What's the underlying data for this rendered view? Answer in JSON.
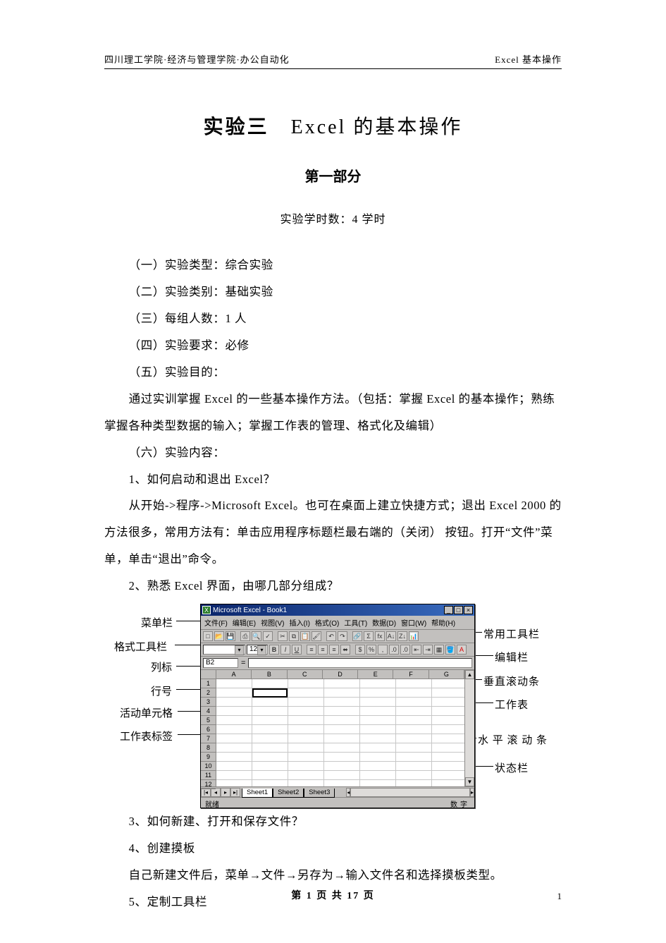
{
  "header": {
    "left": "四川理工学院·经济与管理学院·办公自动化",
    "right": "Excel 基本操作"
  },
  "title": {
    "bold": "实验三",
    "rest": "　Excel 的基本操作"
  },
  "subtitle": "第一部分",
  "hours": "实验学时数：4 学时",
  "items": {
    "i1": "（一）实验类型：综合实验",
    "i2": "（二）实验类别：基础实验",
    "i3": "（三）每组人数：1 人",
    "i4": "（四）实验要求：必修",
    "i5": "（五）实验目的：",
    "i5p": "通过实训掌握 Excel 的一些基本操作方法。（包括：掌握 Excel 的基本操作；熟练掌握各种类型数据的输入；掌握工作表的管理、格式化及编辑）",
    "i6": "（六）实验内容：",
    "q1": "1、如何启动和退出 Excel？",
    "q1p": "从开始->程序->Microsoft Excel。也可在桌面上建立快捷方式；退出 Excel 2000 的方法很多，常用方法有：单击应用程序标题栏最右端的（关闭） 按钮。打开“文件”菜单，单击“退出”命令。",
    "q2": "2、熟悉 Excel 界面，由哪几部分组成？",
    "q3": "3、如何新建、打开和保存文件？",
    "q4": "4、创建摸板",
    "q4p": "自己新建文件后，菜单→文件→另存为→输入文件名和选择摸板类型。",
    "q5": "5、定制工具栏"
  },
  "figure": {
    "left_labels": {
      "menubar": "菜单栏",
      "fmtbar": "格式工具栏",
      "colhdr": "列标",
      "rowhdr": "行号",
      "active": "活动单元格",
      "tabs": "工作表标签"
    },
    "right_labels": {
      "toolbar": "常用工具栏",
      "editbar": "编辑栏",
      "vscroll": "垂直滚动条",
      "sheet": "工作表",
      "hscroll": "水 平 滚 动 条",
      "status": "状态栏"
    },
    "window": {
      "title": "Microsoft Excel - Book1",
      "menus": [
        "文件(F)",
        "编辑(E)",
        "视图(V)",
        "插入(I)",
        "格式(O)",
        "工具(T)",
        "数据(D)",
        "窗口(W)",
        "帮助(H)"
      ],
      "font_size": "12",
      "namebox": "B2",
      "cols": [
        "A",
        "B",
        "C",
        "D",
        "E",
        "F",
        "G"
      ],
      "rows": [
        "1",
        "2",
        "3",
        "4",
        "5",
        "6",
        "7",
        "8",
        "9",
        "10",
        "11",
        "12"
      ],
      "sheets": [
        "Sheet1",
        "Sheet2",
        "Sheet3"
      ],
      "status_left": "就绪",
      "status_right": "数字"
    }
  },
  "footer": {
    "center": "第 1 页 共 17 页",
    "pagenum": "1"
  }
}
